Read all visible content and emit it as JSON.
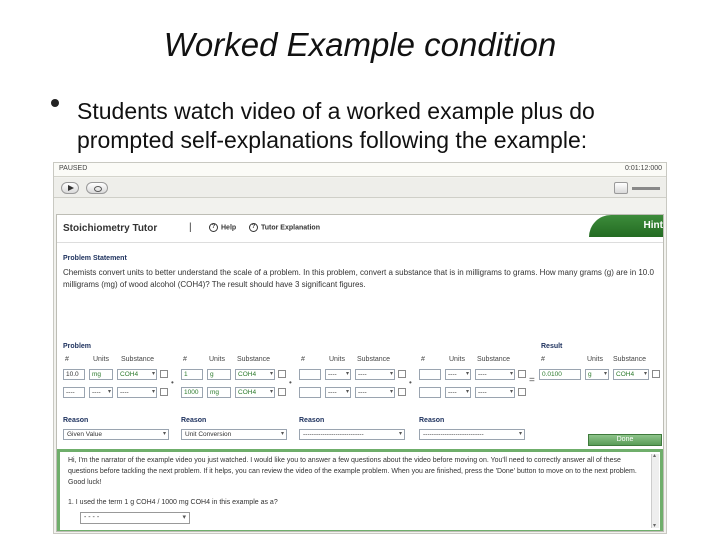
{
  "slide": {
    "title": "Worked Example condition",
    "bullet": "Students watch video of a worked example plus do prompted self-explanations following the example:"
  },
  "player": {
    "status": "PAUSED",
    "timecode": "0:01:12:000"
  },
  "tutor": {
    "title": "Stoichiometry Tutor",
    "separator": "|",
    "help_label": "Help",
    "explanation_label": "Tutor Explanation",
    "hint_label": "Hint",
    "problem_statement_heading": "Problem Statement",
    "problem_statement": "Chemists convert units to better understand the scale of a problem. In this problem, convert a substance that is in milligrams to grams. How many grams (g) are in 10.0 milligrams (mg) of wood alcohol (COH4)? The result should have 3 significant figures.",
    "problem_heading": "Problem",
    "result_heading": "Result",
    "columns": {
      "num": "#",
      "units": "Units",
      "substance": "Substance"
    },
    "terms": [
      {
        "top": {
          "num": "10.0",
          "units": "mg",
          "substance": "COH4"
        },
        "bottom": {
          "num": "----",
          "units": "----",
          "substance": "----"
        }
      },
      {
        "top": {
          "num": "1",
          "units": "g",
          "substance": "COH4"
        },
        "bottom": {
          "num": "1000",
          "units": "mg",
          "substance": "COH4"
        }
      },
      {
        "top": {
          "num": "",
          "units": "----",
          "substance": "----"
        },
        "bottom": {
          "num": "",
          "units": "----",
          "substance": "----"
        }
      },
      {
        "top": {
          "num": "",
          "units": "----",
          "substance": "----"
        },
        "bottom": {
          "num": "",
          "units": "----",
          "substance": "----"
        }
      }
    ],
    "equals": "=",
    "result": {
      "num": "0.0100",
      "units": "g",
      "substance": "COH4"
    },
    "reason_label": "Reason",
    "reasons": [
      "Given Value",
      "Unit Conversion",
      "----------------------------",
      "----------------------------"
    ],
    "done_label": "Done",
    "self_explanation_text": "Hi, I'm the narrator of the example video you just watched. I would like you to answer a few questions about the video before moving on. You'll need to correctly answer all of these questions before tackling the next problem. If it helps, you can review the video of the example problem. When you are finished, press the 'Done' button to move on to the next problem. Good luck!",
    "question": "1. I used the term 1 g COH4 / 1000 mg COH4 in this example as a?",
    "answer_value": "- - - -"
  }
}
